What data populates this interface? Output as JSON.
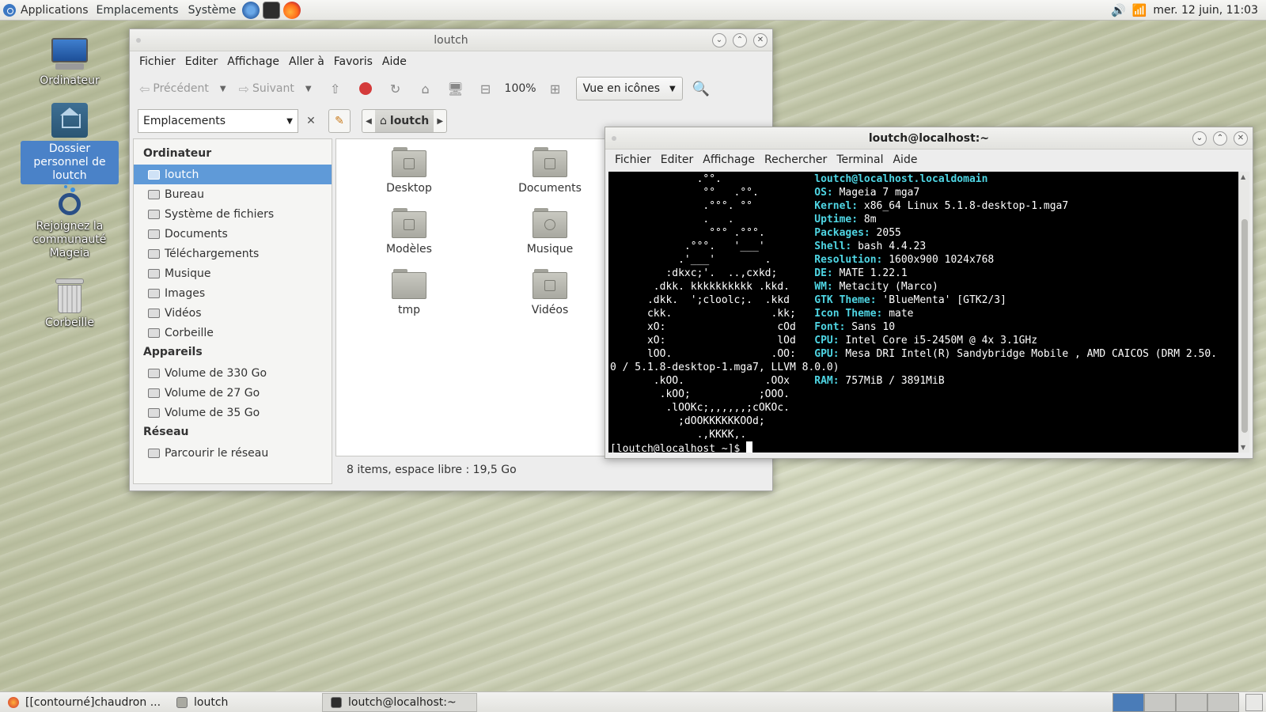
{
  "top_panel": {
    "menus": [
      "Applications",
      "Emplacements",
      "Système"
    ],
    "clock": "mer. 12 juin, 11:03"
  },
  "desktop": {
    "icons": [
      {
        "label": "Ordinateur"
      },
      {
        "label": "Dossier personnel de loutch"
      },
      {
        "label": "Rejoignez la communauté Mageia"
      },
      {
        "label": "Corbeille"
      }
    ]
  },
  "caja": {
    "title": "loutch",
    "menu": [
      "Fichier",
      "Editer",
      "Affichage",
      "Aller à",
      "Favoris",
      "Aide"
    ],
    "toolbar": {
      "back": "Précédent",
      "forward": "Suivant",
      "zoom": "100%",
      "view_mode": "Vue en icônes"
    },
    "location": {
      "places_select": "Emplacements",
      "crumb": "loutch"
    },
    "sidebar": {
      "sections": [
        {
          "heading": "Ordinateur",
          "items": [
            "loutch",
            "Bureau",
            "Système de fichiers",
            "Documents",
            "Téléchargements",
            "Musique",
            "Images",
            "Vidéos",
            "Corbeille"
          ]
        },
        {
          "heading": "Appareils",
          "items": [
            "Volume de 330 Go",
            "Volume de 27 Go",
            "Volume de 35 Go"
          ]
        },
        {
          "heading": "Réseau",
          "items": [
            "Parcourir le réseau"
          ]
        }
      ],
      "selected": "loutch"
    },
    "files": [
      "Desktop",
      "Documents",
      "Modèles",
      "Musique",
      "tmp",
      "Vidéos"
    ],
    "status": "8 items, espace libre : 19,5 Go"
  },
  "terminal": {
    "title": "loutch@localhost:~",
    "menu": [
      "Fichier",
      "Editer",
      "Affichage",
      "Rechercher",
      "Terminal",
      "Aide"
    ],
    "user_host": "loutch@localhost.localdomain",
    "info": [
      {
        "label": "OS:",
        "value": " Mageia 7 mga7"
      },
      {
        "label": "Kernel:",
        "value": " x86_64 Linux 5.1.8-desktop-1.mga7"
      },
      {
        "label": "Uptime:",
        "value": " 8m"
      },
      {
        "label": "Packages:",
        "value": " 2055"
      },
      {
        "label": "Shell:",
        "value": " bash 4.4.23"
      },
      {
        "label": "Resolution:",
        "value": " 1600x900 1024x768"
      },
      {
        "label": "DE:",
        "value": " MATE 1.22.1"
      },
      {
        "label": "WM:",
        "value": " Metacity (Marco)"
      },
      {
        "label": "GTK Theme:",
        "value": " 'BlueMenta' [GTK2/3]"
      },
      {
        "label": "Icon Theme:",
        "value": " mate"
      },
      {
        "label": "Font:",
        "value": " Sans 10"
      },
      {
        "label": "CPU:",
        "value": " Intel Core i5-2450M @ 4x 3.1GHz"
      },
      {
        "label": "GPU:",
        "value": " Mesa DRI Intel(R) Sandybridge Mobile , AMD CAICOS (DRM 2.50."
      },
      {
        "label": "RAM:",
        "value": " 757MiB / 3891MiB"
      }
    ],
    "gpu_wrap": "0 / 5.1.8-desktop-1.mga7, LLVM 8.0.0)",
    "ascii_art": [
      "              .°°.",
      "               °°   .°°.",
      "               .°°°. °°",
      "               .   .",
      "                °°° .°°°.",
      "            .°°°.   '___'",
      "           .'___'        .",
      "         :dkxc;'.  ..,cxkd;",
      "       .dkk. kkkkkkkkkk .kkd.",
      "      .dkk.  ';cloolc;.  .kkd",
      "      ckk.                .kk;",
      "      xO:                  cOd",
      "      xO:                  lOd",
      "      lOO.                .OO:",
      "",
      "       .kOO.             .OOx",
      "        .kOO;           ;OOO.",
      "         .lOOKc;,,,,,,;cOKOc.",
      "           ;dOOKKKKKKOOd;",
      "              .,KKKK,."
    ],
    "prompt": "[loutch@localhost ~]$ "
  },
  "bottom_panel": {
    "tasks": [
      "[[contourné]chaudron ...",
      "loutch",
      "loutch@localhost:~"
    ]
  }
}
